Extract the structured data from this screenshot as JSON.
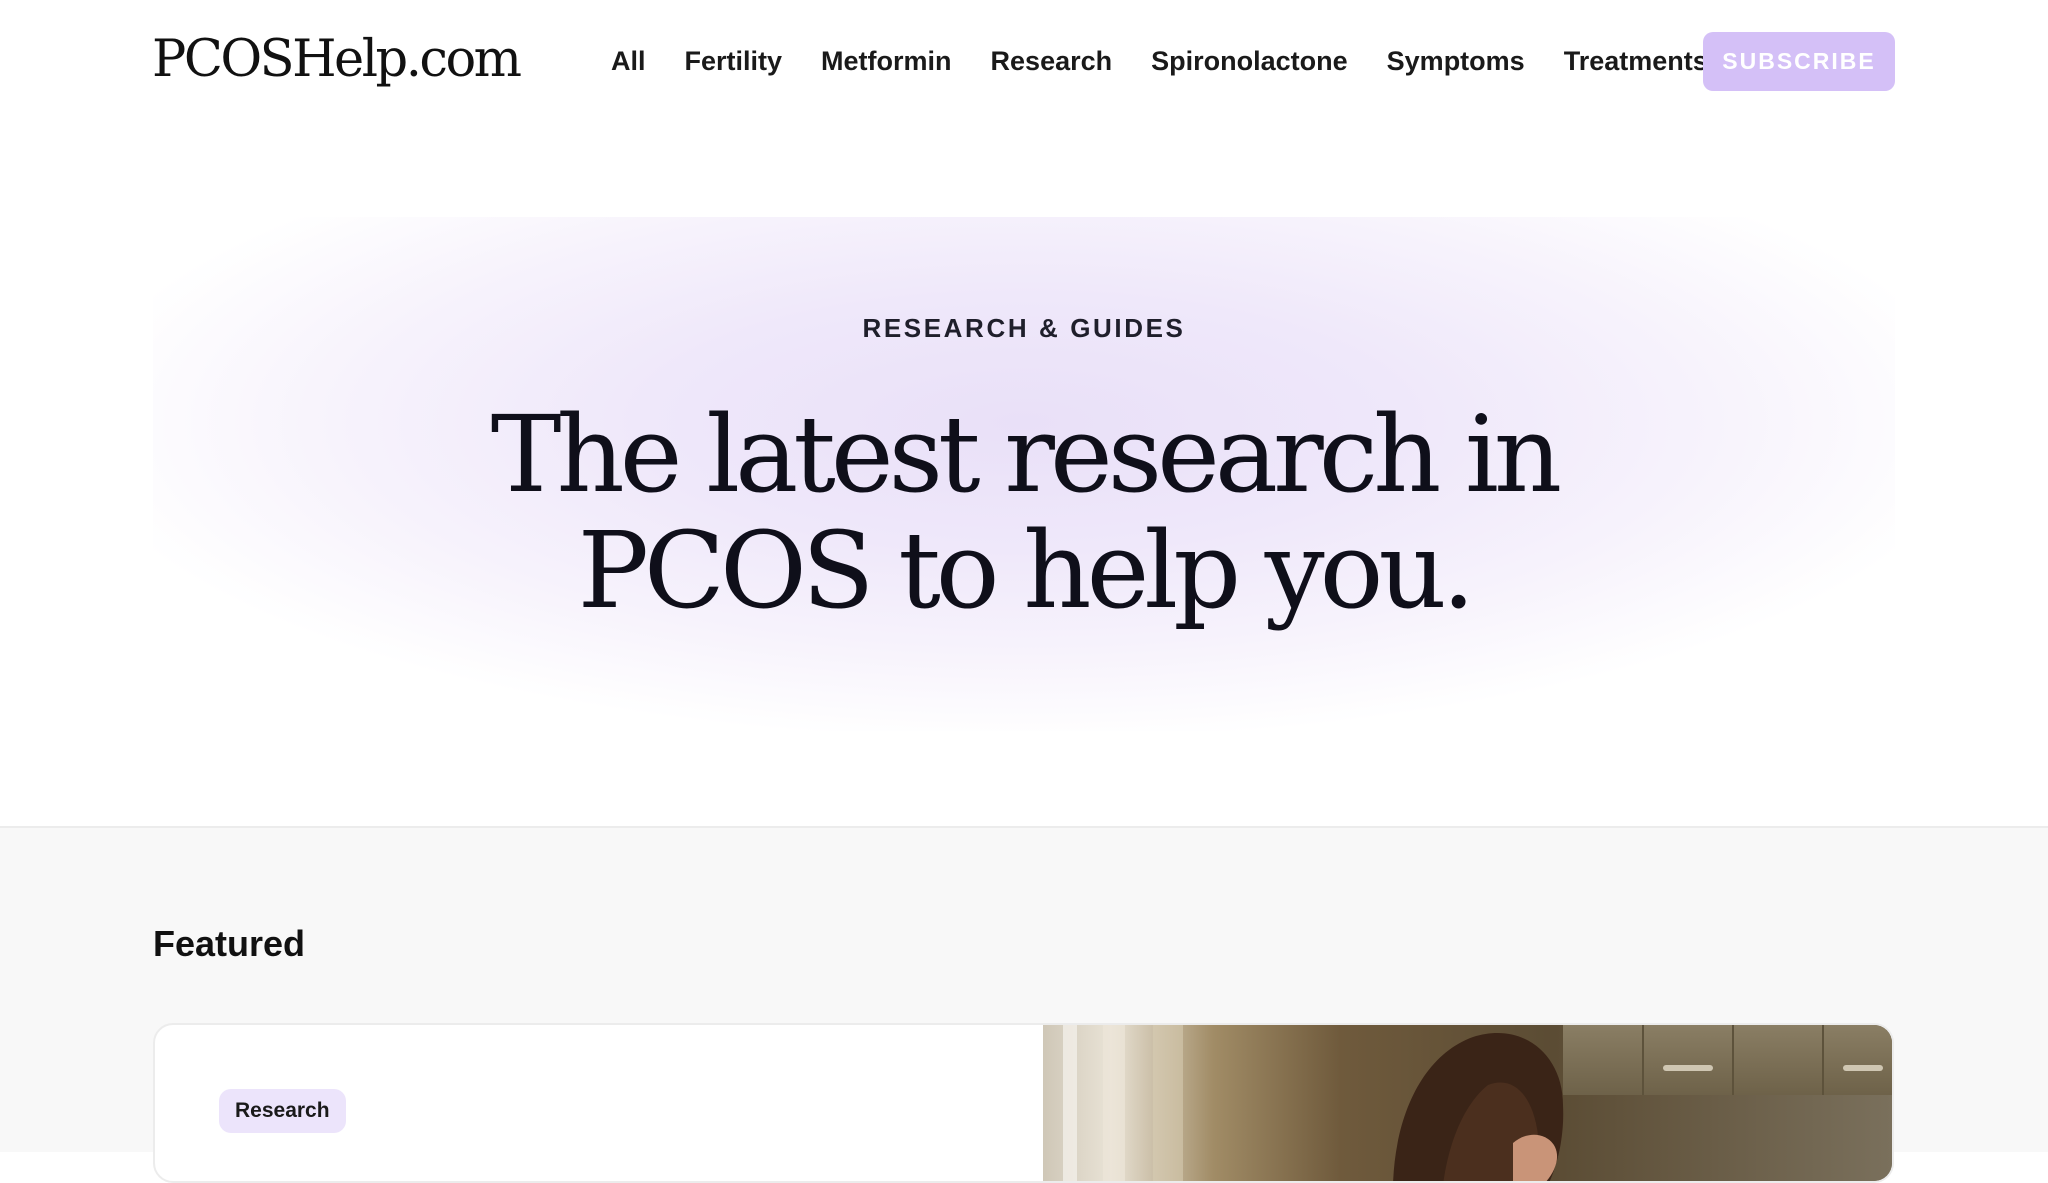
{
  "header": {
    "logo": "PCOSHelp.com",
    "nav": [
      "All",
      "Fertility",
      "Metformin",
      "Research",
      "Spironolactone",
      "Symptoms",
      "Treatments"
    ],
    "subscribe_label": "SUBSCRIBE"
  },
  "hero": {
    "eyebrow": "RESEARCH & GUIDES",
    "title_line1": "The latest research in",
    "title_line2": "PCOS to help you."
  },
  "featured": {
    "heading": "Featured",
    "card": {
      "tag": "Research",
      "image_icon": "photo-of-woman"
    }
  },
  "colors": {
    "accent_button": "#d4c0f7",
    "tag_background": "#ece4fb",
    "hero_gradient_center": "#e9e0f8",
    "section_background": "#f8f8f8"
  }
}
